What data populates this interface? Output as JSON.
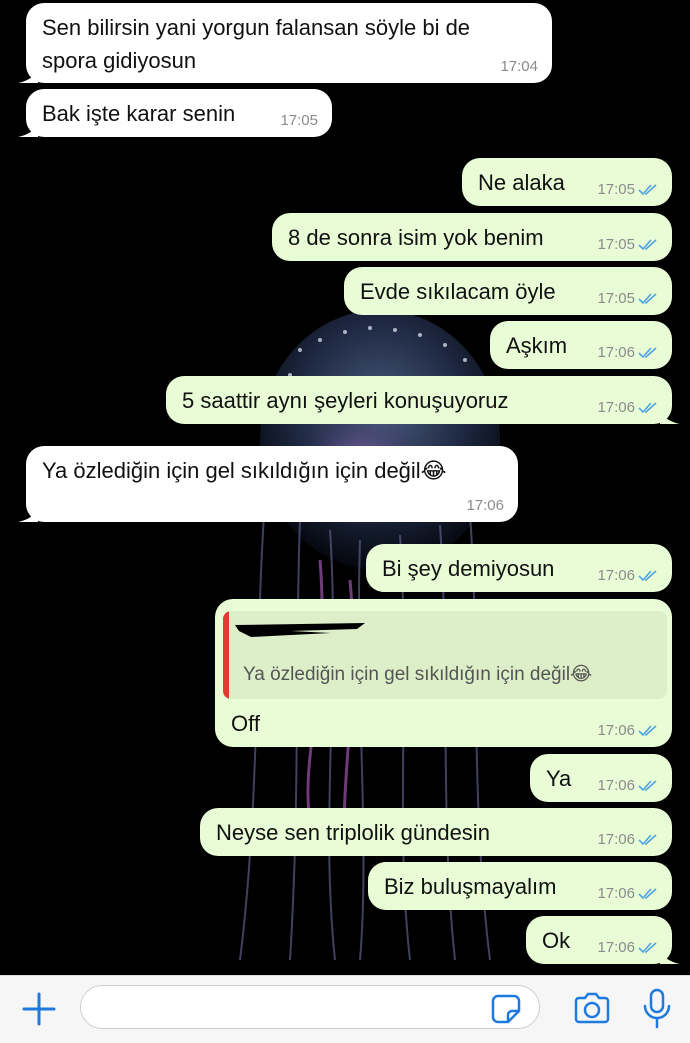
{
  "messages": [
    {
      "dir": "in",
      "text_lines": [
        "Sen bilirsin yani yorgun falansan söyle bi de",
        "spora gidiyosun"
      ],
      "time": "17:04"
    },
    {
      "dir": "in",
      "text": "Bak işte karar senin",
      "time": "17:05"
    },
    {
      "dir": "out",
      "text": "Ne alaka",
      "time": "17:05",
      "status": "read"
    },
    {
      "dir": "out",
      "text": "8 de sonra isim yok benim",
      "time": "17:05",
      "status": "read"
    },
    {
      "dir": "out",
      "text": "Evde sıkılacam öyle",
      "time": "17:05",
      "status": "read"
    },
    {
      "dir": "out",
      "text": "Aşkım",
      "time": "17:06",
      "status": "read"
    },
    {
      "dir": "out",
      "text": "5 saattir aynı şeyleri konuşuyoruz",
      "time": "17:06",
      "status": "read"
    },
    {
      "dir": "in",
      "text": "Ya özlediğin için gel sıkıldığın için değil😂",
      "time": "17:06"
    },
    {
      "dir": "out",
      "text": "Bi şey demiyosun",
      "time": "17:06",
      "status": "read"
    },
    {
      "dir": "out",
      "quote": {
        "text": "Ya özlediğin için gel sıkıldığın için değil😂",
        "author": "redacted"
      },
      "text": "Off",
      "time": "17:06",
      "status": "read"
    },
    {
      "dir": "out",
      "text": "Ya",
      "time": "17:06",
      "status": "read"
    },
    {
      "dir": "out",
      "text": "Neyse sen triplolik gündesin",
      "time": "17:06",
      "status": "read"
    },
    {
      "dir": "out",
      "text": "Biz buluşmayalım",
      "time": "17:06",
      "status": "read"
    },
    {
      "dir": "out",
      "text": "Ok",
      "time": "17:06",
      "status": "read"
    }
  ],
  "input": {
    "placeholder": "",
    "value": ""
  },
  "icons": {
    "add": "plus-icon",
    "sticker": "sticker-icon",
    "camera": "camera-icon",
    "mic": "microphone-icon"
  },
  "colors": {
    "incoming_bubble": "#ffffff",
    "outgoing_bubble": "#e8fcd6",
    "read_ticks": "#4fa3e0",
    "accent": "#1f7ae0",
    "quote_bar": "#e53935"
  }
}
